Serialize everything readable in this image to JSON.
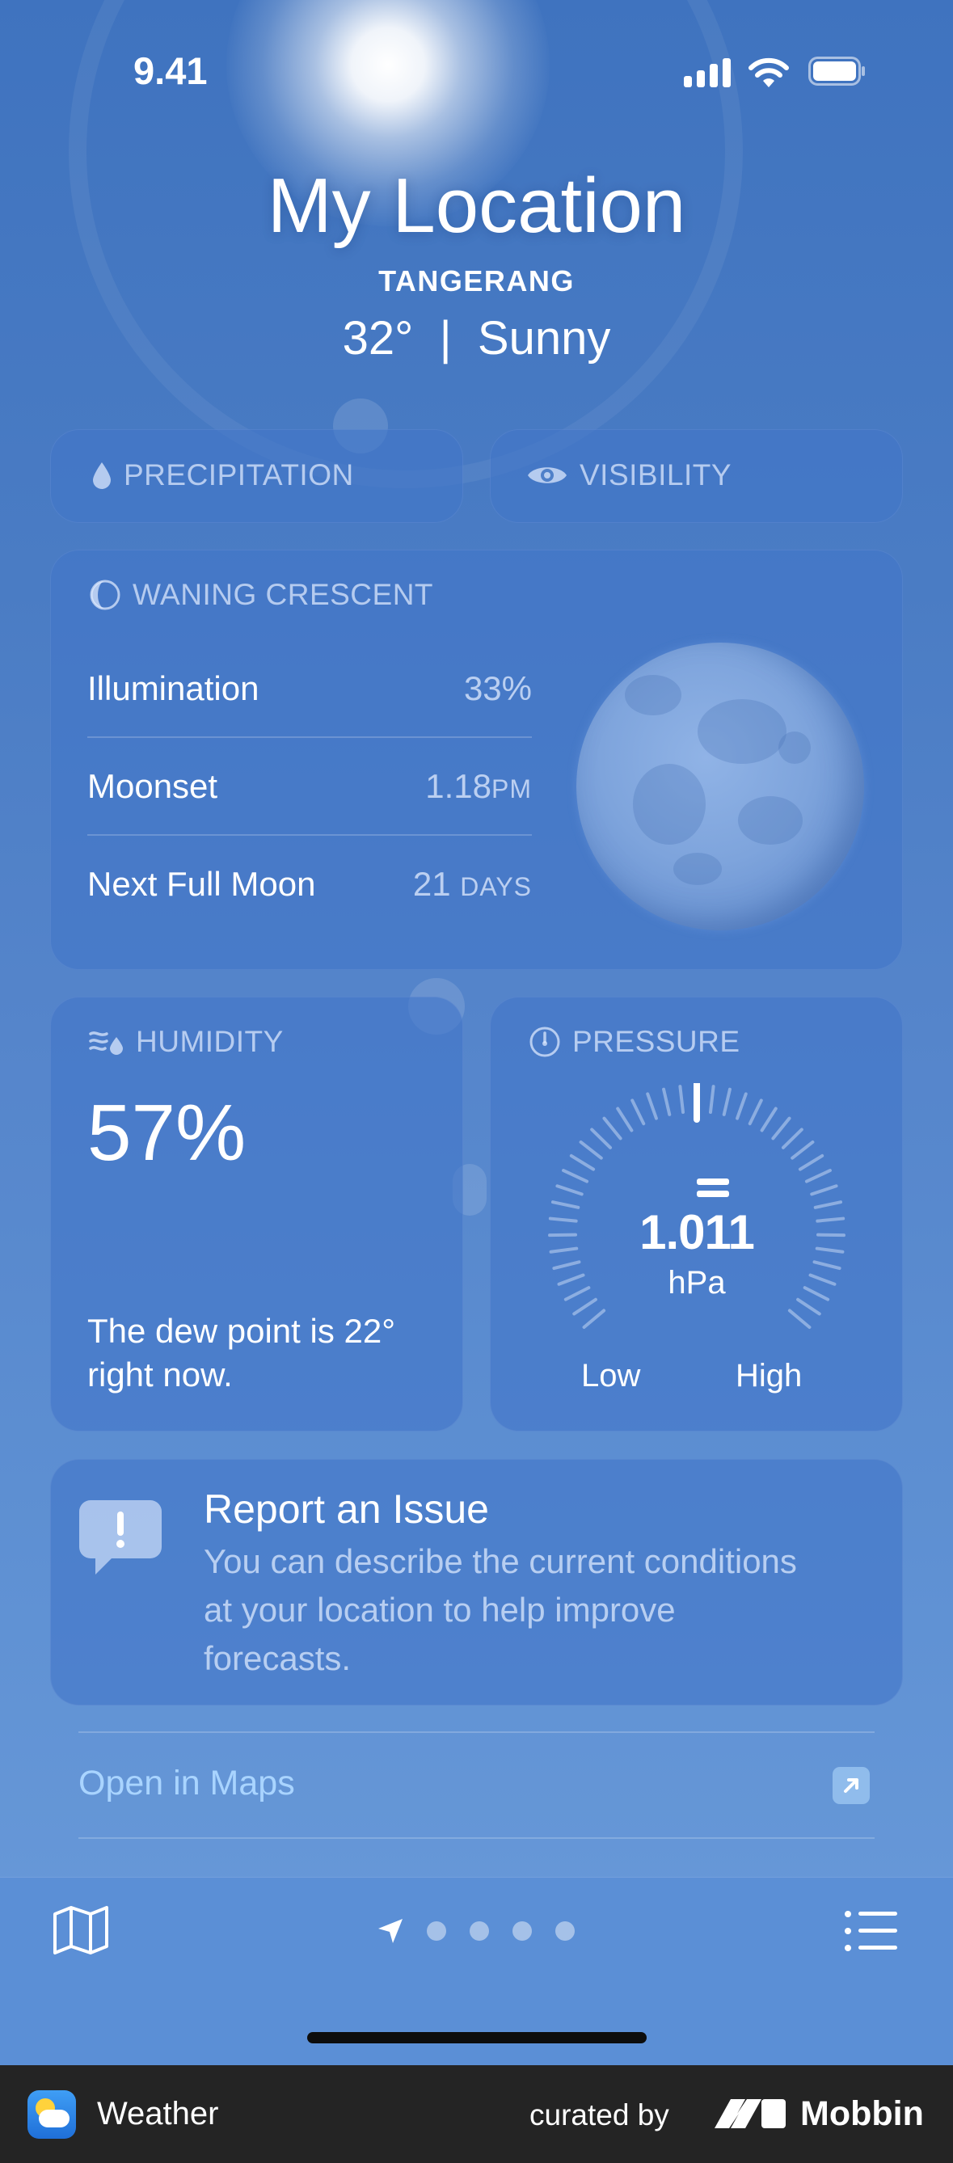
{
  "status": {
    "time": "9.41"
  },
  "header": {
    "location": "My Location",
    "city": "TANGERANG",
    "temp": "32°",
    "condition": "Sunny"
  },
  "cards": {
    "precipitation": "PRECIPITATION",
    "visibility": "VISIBILITY",
    "moon": {
      "title": "WANING CRESCENT",
      "rows": [
        {
          "label": "Illumination",
          "value": "33%",
          "unit": ""
        },
        {
          "label": "Moonset",
          "value": "1.18",
          "unit": "PM"
        },
        {
          "label": "Next Full Moon",
          "value": "21",
          "unit": "DAYS"
        }
      ]
    },
    "humidity": {
      "title": "HUMIDITY",
      "value": "57%",
      "desc": "The dew point is 22° right now."
    },
    "pressure": {
      "title": "PRESSURE",
      "value": "1.011",
      "unit": "hPa",
      "low": "Low",
      "high": "High"
    }
  },
  "report": {
    "title": "Report an Issue",
    "desc": "You can describe the current conditions at your location to help improve forecasts."
  },
  "maps": {
    "label": "Open in Maps"
  },
  "tabbar": {
    "page_count": 4,
    "icons": [
      "map-icon",
      "location-arrow-icon",
      "list-icon"
    ]
  },
  "footer": {
    "app": "Weather",
    "curated": "curated by",
    "brand": "Mobbin"
  },
  "colors": {
    "sky": "#4a7cc4",
    "card": "#4276c8",
    "link": "#a9d4ff",
    "tabbar": "#5b8fd6",
    "footer": "#242424"
  }
}
